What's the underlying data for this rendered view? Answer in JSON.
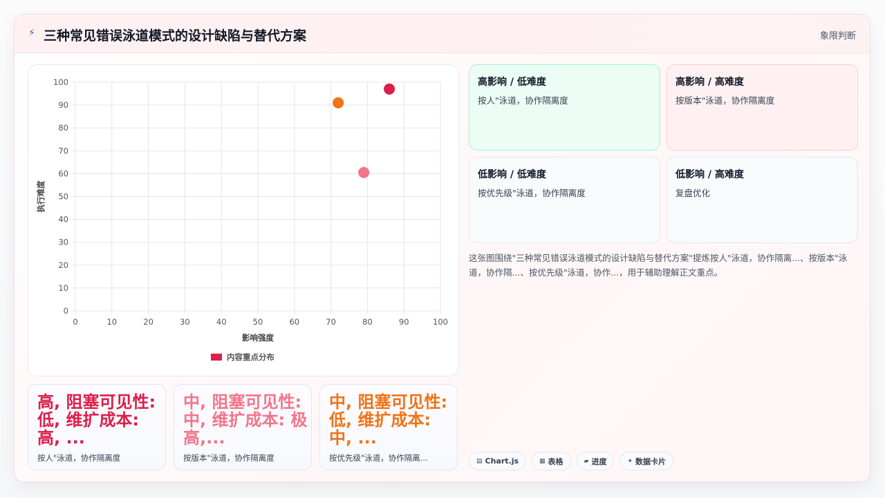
{
  "header": {
    "icon": "lightning-icon",
    "title": "三种常见错误泳道模式的设计缺陷与替代方案",
    "tag": "象限判断"
  },
  "chart_data": {
    "type": "scatter",
    "xlabel": "影响强度",
    "ylabel": "执行难度",
    "xlim": [
      0,
      100
    ],
    "ylim": [
      0,
      100
    ],
    "xticks": [
      0,
      10,
      20,
      30,
      40,
      50,
      60,
      70,
      80,
      90,
      100
    ],
    "yticks": [
      0,
      10,
      20,
      30,
      40,
      50,
      60,
      70,
      80,
      90,
      100
    ],
    "grid": true,
    "legend": {
      "position": "bottom",
      "label": "内容重点分布",
      "color": "#dc1e4a"
    },
    "points": [
      {
        "x": 86,
        "y": 97,
        "color": "#dc1e4a"
      },
      {
        "x": 72,
        "y": 91,
        "color": "#f07316"
      },
      {
        "x": 79,
        "y": 60.5,
        "color": "#f2758a"
      }
    ]
  },
  "metrics": [
    {
      "value": "高, 阻塞可见性: 低, 维扩成本: 高, ...",
      "label": "按人\"泳道，协作隔离度",
      "color": "#dc1e4a"
    },
    {
      "value": "中, 阻塞可见性: 中, 维扩成本: 极高,...",
      "label": "按版本\"泳道，协作隔离度",
      "color": "#f2758a"
    },
    {
      "value": "中, 阻塞可见性: 低, 维扩成本: 中, ...",
      "label": "按优先级\"泳道，协作隔离...",
      "color": "#f07316"
    }
  ],
  "quadrants": [
    {
      "title": "高影响 / 低难度",
      "desc": "按人\"泳道，协作隔离度",
      "bg": "#ecfdf5",
      "border": "#a7f3d0"
    },
    {
      "title": "高影响 / 高难度",
      "desc": "按版本\"泳道，协作隔离度",
      "bg": "#fff1f2",
      "border": "#fecdd3"
    },
    {
      "title": "低影响 / 低难度",
      "desc": "按优先级\"泳道，协作隔离度",
      "bg": "#f8fafc",
      "border": "#e2e8f0"
    },
    {
      "title": "低影响 / 高难度",
      "desc": "复盘优化",
      "bg": "#f8fafc",
      "border": "#e2e8f0"
    }
  ],
  "summary": "这张图围绕\"三种常见错误泳道模式的设计缺陷与替代方案\"提炼按人\"泳道，协作隔离...、按版本\"泳道，协作隔...、按优先级\"泳道，协作...，用于辅助理解正文重点。",
  "tags": [
    {
      "icon": "chart-icon",
      "glyph": "▤",
      "label": "Chart.js"
    },
    {
      "icon": "table-icon",
      "glyph": "▦",
      "label": "表格"
    },
    {
      "icon": "progress-icon",
      "glyph": "▰",
      "label": "进度"
    },
    {
      "icon": "sparkle-icon",
      "glyph": "✦",
      "label": "数据卡片"
    }
  ]
}
